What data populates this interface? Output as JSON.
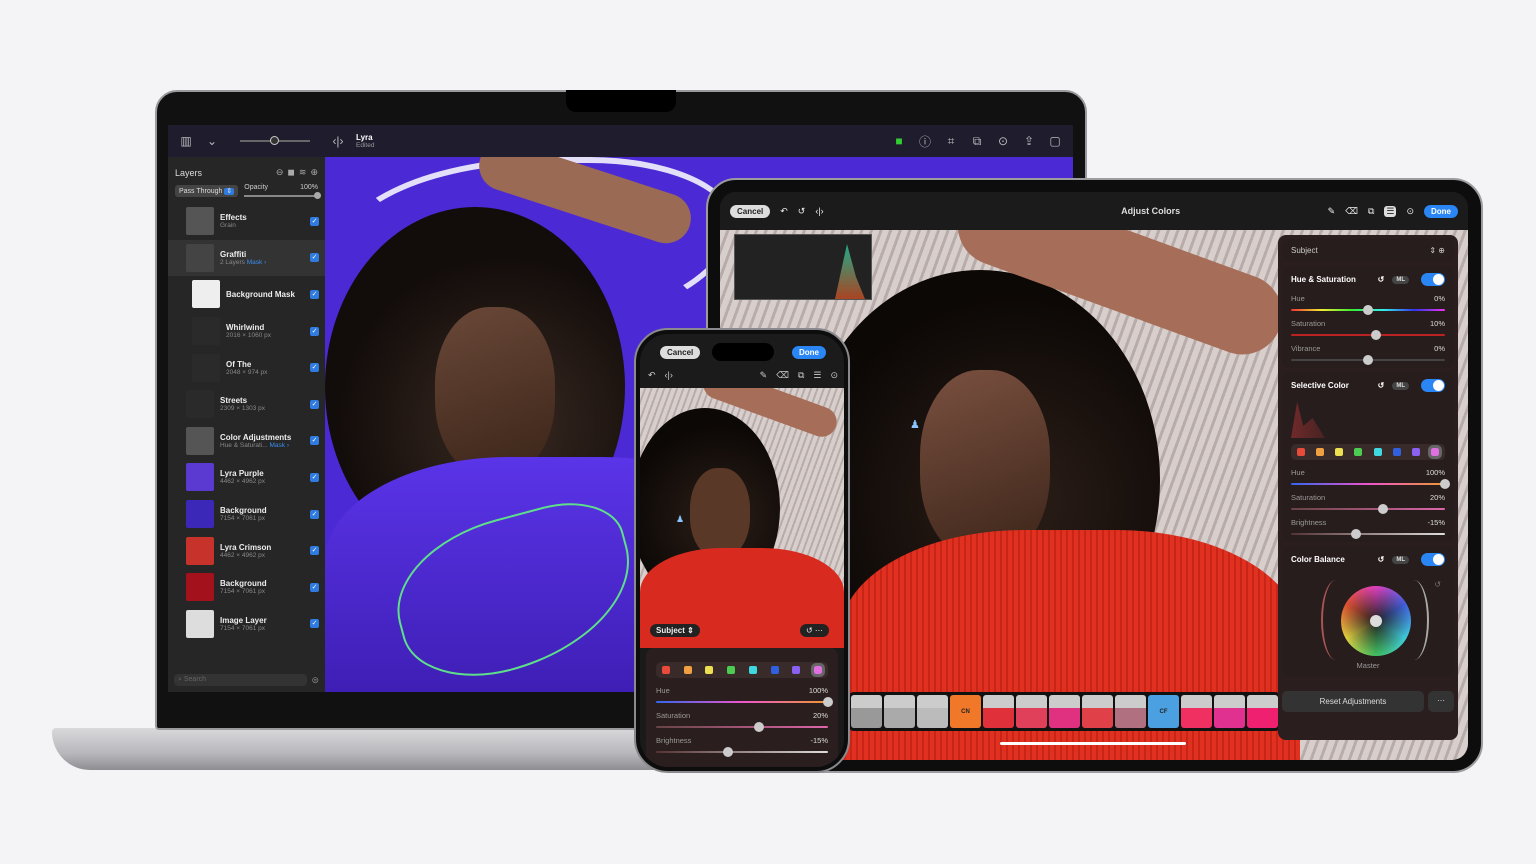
{
  "mac": {
    "toolbar": {
      "doc_title": "Lyra",
      "doc_status": "Edited"
    },
    "layers_panel": {
      "title": "Layers",
      "blend_mode": "Pass Through",
      "opacity_label": "Opacity",
      "opacity_value": "100%",
      "search_placeholder": "Search",
      "layers": [
        {
          "name": "Effects",
          "sub": "Grain",
          "thumb": "#555",
          "selected": false,
          "indent": false
        },
        {
          "name": "Graffiti",
          "sub": "2 Layers",
          "mask": "Mask ›",
          "thumb": "#444",
          "selected": true,
          "indent": false
        },
        {
          "name": "Background Mask",
          "sub": "",
          "thumb": "#eee",
          "selected": false,
          "indent": true
        },
        {
          "name": "Whirlwind",
          "sub": "2016 × 1060 px",
          "thumb": "#2a2a2a",
          "selected": false,
          "indent": true
        },
        {
          "name": "Of The",
          "sub": "2048 × 974 px",
          "thumb": "#2a2a2a",
          "selected": false,
          "indent": true
        },
        {
          "name": "Streets",
          "sub": "2309 × 1303 px",
          "thumb": "#2a2a2a",
          "selected": false,
          "indent": false
        },
        {
          "name": "Color Adjustments",
          "sub": "Hue & Saturati...",
          "mask": "Mask ›",
          "thumb": "#555",
          "selected": false,
          "indent": false
        },
        {
          "name": "Lyra Purple",
          "sub": "4462 × 4962 px",
          "thumb": "#5a3ad0",
          "selected": false,
          "indent": false
        },
        {
          "name": "Background",
          "sub": "7154 × 7061 px",
          "thumb": "#3b27b8",
          "selected": false,
          "indent": false
        },
        {
          "name": "Lyra Crimson",
          "sub": "4462 × 4962 px",
          "thumb": "#c7322a",
          "selected": false,
          "indent": false
        },
        {
          "name": "Background",
          "sub": "7154 × 7061 px",
          "thumb": "#a3121c",
          "selected": false,
          "indent": false
        },
        {
          "name": "Image Layer",
          "sub": "7154 × 7061 px",
          "thumb": "#ddd",
          "selected": false,
          "indent": false
        }
      ]
    }
  },
  "ipad": {
    "toolbar": {
      "cancel": "Cancel",
      "title": "Adjust Colors",
      "done": "Done"
    },
    "panel": {
      "subject": "Subject",
      "hue_saturation": {
        "title": "Hue & Saturation",
        "ml": "ML",
        "enabled": true,
        "sliders": [
          {
            "label": "Hue",
            "value": "0%",
            "pos": 0.5
          },
          {
            "label": "Saturation",
            "value": "10%",
            "pos": 0.55
          },
          {
            "label": "Vibrance",
            "value": "0%",
            "pos": 0.5
          }
        ]
      },
      "selective_color": {
        "title": "Selective Color",
        "ml": "ML",
        "enabled": true,
        "swatches": [
          "#e84a3c",
          "#f0a040",
          "#ece050",
          "#4ccc50",
          "#40d8e0",
          "#3060e0",
          "#8a60f0",
          "#e070e0"
        ],
        "sliders": [
          {
            "label": "Hue",
            "value": "100%",
            "pos": 1.0
          },
          {
            "label": "Saturation",
            "value": "20%",
            "pos": 0.6
          },
          {
            "label": "Brightness",
            "value": "-15%",
            "pos": 0.42
          }
        ]
      },
      "color_balance": {
        "title": "Color Balance",
        "ml": "ML",
        "enabled": true,
        "wheel_label": "Master"
      },
      "reset": "Reset Adjustments"
    },
    "presets": [
      {
        "label": "",
        "color": "#999"
      },
      {
        "label": "",
        "color": "#aaa"
      },
      {
        "label": "",
        "color": "#bbb"
      },
      {
        "label": "CN",
        "color": "#f07828"
      },
      {
        "label": "",
        "color": "#e0303a"
      },
      {
        "label": "",
        "color": "#e0405a"
      },
      {
        "label": "",
        "color": "#e03080"
      },
      {
        "label": "",
        "color": "#e04048"
      },
      {
        "label": "",
        "color": "#b07080"
      },
      {
        "label": "CF",
        "color": "#4aa0e0"
      },
      {
        "label": "",
        "color": "#f03060"
      },
      {
        "label": "",
        "color": "#e03090"
      },
      {
        "label": "",
        "color": "#f02070"
      }
    ]
  },
  "iphone": {
    "cancel": "Cancel",
    "done": "Done",
    "subject": "Subject",
    "swatches": [
      "#e84a3c",
      "#f0a040",
      "#ece050",
      "#4ccc50",
      "#40d8e0",
      "#3060e0",
      "#8a60f0",
      "#e070e0"
    ],
    "sliders": [
      {
        "label": "Hue",
        "value": "100%",
        "pos": 1.0
      },
      {
        "label": "Saturation",
        "value": "20%",
        "pos": 0.6
      },
      {
        "label": "Brightness",
        "value": "-15%",
        "pos": 0.42
      }
    ]
  },
  "colors": {
    "accent": "#2a86f5",
    "mac_canvas": "#4b2ad6",
    "sweater_red": "#d82a1e"
  }
}
